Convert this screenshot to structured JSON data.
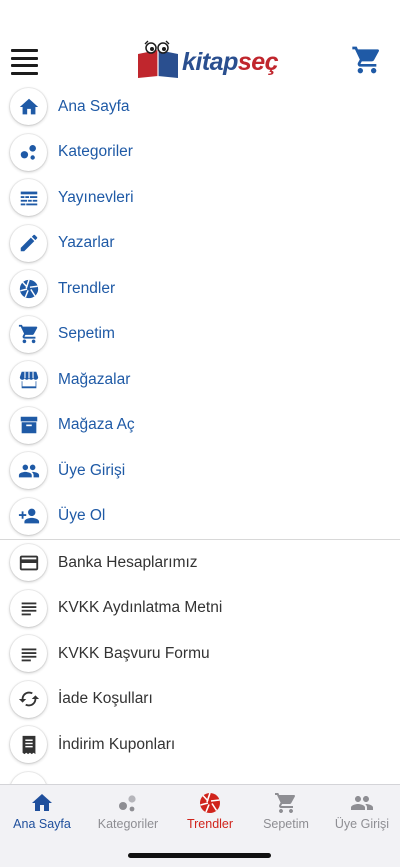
{
  "header": {
    "logo_left": "kitap",
    "logo_right": "seç"
  },
  "menu_primary": [
    {
      "label": "Ana Sayfa",
      "icon": "home-icon"
    },
    {
      "label": "Kategoriler",
      "icon": "categories-icon"
    },
    {
      "label": "Yayınevleri",
      "icon": "publishers-icon"
    },
    {
      "label": "Yazarlar",
      "icon": "pencil-icon"
    },
    {
      "label": "Trendler",
      "icon": "aperture-icon"
    },
    {
      "label": "Sepetim",
      "icon": "cart-icon"
    },
    {
      "label": "Mağazalar",
      "icon": "store-icon"
    },
    {
      "label": "Mağaza Aç",
      "icon": "archive-icon"
    },
    {
      "label": "Üye Girişi",
      "icon": "users-icon"
    },
    {
      "label": "Üye Ol",
      "icon": "person-add-icon"
    }
  ],
  "menu_secondary": [
    {
      "label": "Banka Hesaplarımız",
      "icon": "credit-card-icon"
    },
    {
      "label": "KVKK Aydınlatma Metni",
      "icon": "text-lines-icon"
    },
    {
      "label": "KVKK Başvuru Formu",
      "icon": "text-lines-icon"
    },
    {
      "label": "İade Koşulları",
      "icon": "refresh-icon"
    },
    {
      "label": "İndirim Kuponları",
      "icon": "coupon-icon"
    }
  ],
  "tabs": [
    {
      "label": "Ana Sayfa",
      "icon": "home-icon",
      "color": "#1f4f9c"
    },
    {
      "label": "Kategoriler",
      "icon": "categories-icon",
      "color": "#8e8e93"
    },
    {
      "label": "Trendler",
      "icon": "aperture-icon",
      "color": "#d0241c"
    },
    {
      "label": "Sepetim",
      "icon": "cart-icon",
      "color": "#8e8e93"
    },
    {
      "label": "Üye Girişi",
      "icon": "users-icon",
      "color": "#8e8e93"
    }
  ],
  "colors": {
    "primary": "#1f5aa6",
    "brand_blue": "#2a4f8f",
    "brand_red": "#c0262d",
    "active_tab": "#1f4f9c",
    "trend_red": "#d0241c",
    "inactive": "#8e8e93"
  }
}
